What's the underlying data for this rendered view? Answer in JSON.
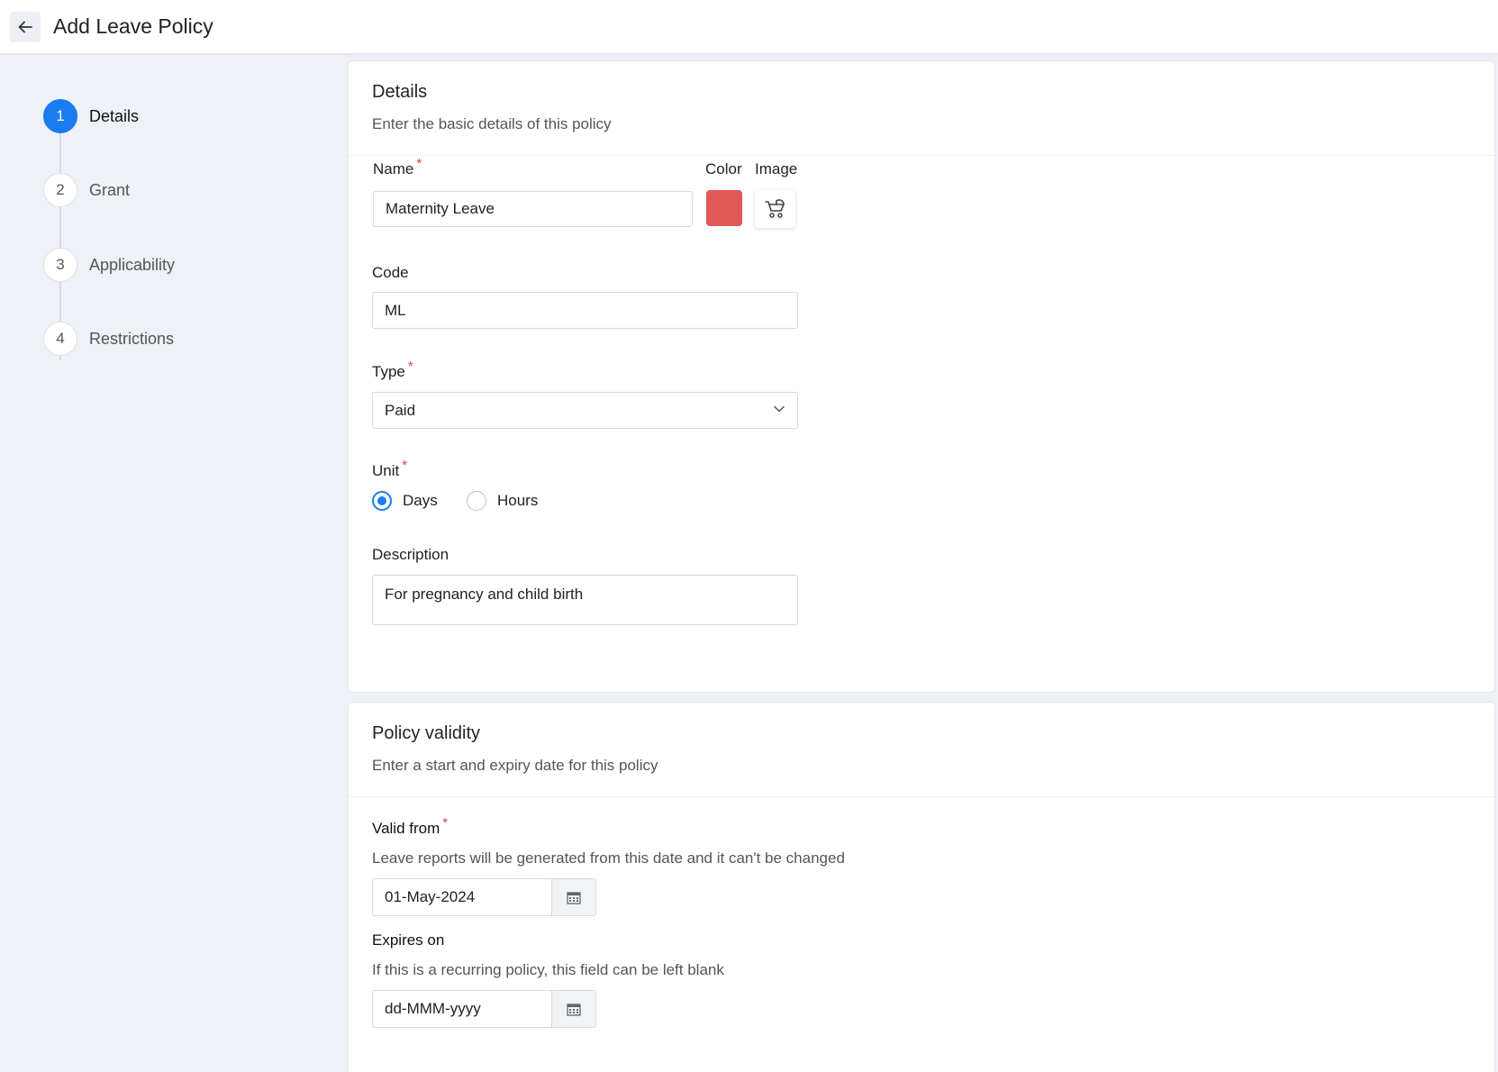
{
  "header": {
    "back_icon": "arrow-left-icon",
    "title": "Add Leave Policy"
  },
  "steps": [
    {
      "number": "1",
      "label": "Details",
      "active": true
    },
    {
      "number": "2",
      "label": "Grant",
      "active": false
    },
    {
      "number": "3",
      "label": "Applicability",
      "active": false
    },
    {
      "number": "4",
      "label": "Restrictions",
      "active": false
    }
  ],
  "details": {
    "title": "Details",
    "subtitle": "Enter the basic details of this policy",
    "name_label": "Name",
    "name_value": "Maternity Leave",
    "color_label": "Color",
    "color_value": "#e05a55",
    "image_label": "Image",
    "image_icon": "stroller-icon",
    "code_label": "Code",
    "code_value": "ML",
    "type_label": "Type",
    "type_value": "Paid",
    "unit_label": "Unit",
    "unit_options": [
      {
        "label": "Days",
        "checked": true
      },
      {
        "label": "Hours",
        "checked": false
      }
    ],
    "description_label": "Description",
    "description_value": "For pregnancy and child birth"
  },
  "validity": {
    "title": "Policy validity",
    "subtitle": "Enter a start and expiry date for this policy",
    "valid_from_label": "Valid from",
    "valid_from_help": "Leave reports will be generated from this date and it can't be changed",
    "valid_from_value": "01-May-2024",
    "expires_label": "Expires on",
    "expires_help": "If this is a recurring policy, this field can be left blank",
    "expires_placeholder": "dd-MMM-yyyy",
    "calendar_icon": "calendar-icon"
  },
  "colors": {
    "accent": "#1a7cf0",
    "required": "#e0413d"
  }
}
